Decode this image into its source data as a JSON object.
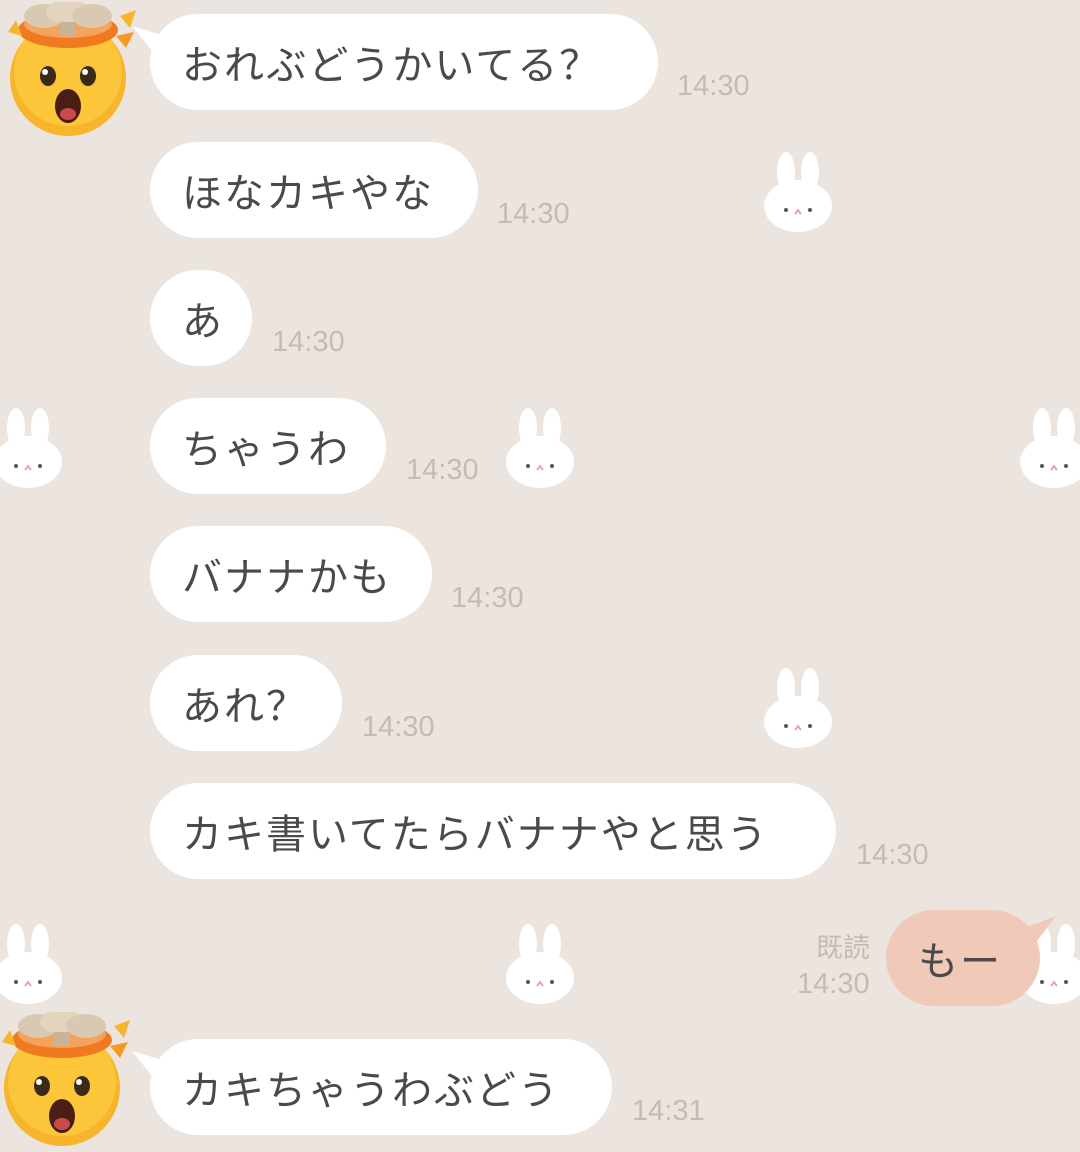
{
  "messages": [
    {
      "text": "おれぶどうかいてる？",
      "time": "14:30"
    },
    {
      "text": "ほなカキやな",
      "time": "14:30"
    },
    {
      "text": "あ",
      "time": "14:30"
    },
    {
      "text": "ちゃうわ",
      "time": "14:30"
    },
    {
      "text": "バナナかも",
      "time": "14:30"
    },
    {
      "text": "あれ？",
      "time": "14:30"
    },
    {
      "text": "カキ書いてたらバナナやと思う",
      "time": "14:30"
    },
    {
      "text": "カキちゃうわぶどう",
      "time": "14:31"
    }
  ],
  "my_message": {
    "text": "もー",
    "read_label": "既読",
    "time": "14:30"
  },
  "avatar_icon": "exploding-head-emoji-icon",
  "wallpaper_icon": "white-bunny-icon",
  "colors": {
    "background": "#ebe4df",
    "incoming_bubble": "#ffffff",
    "outgoing_bubble": "#f0c9b8",
    "timestamp": "#c2bcb6",
    "text": "#4a4a4a"
  }
}
